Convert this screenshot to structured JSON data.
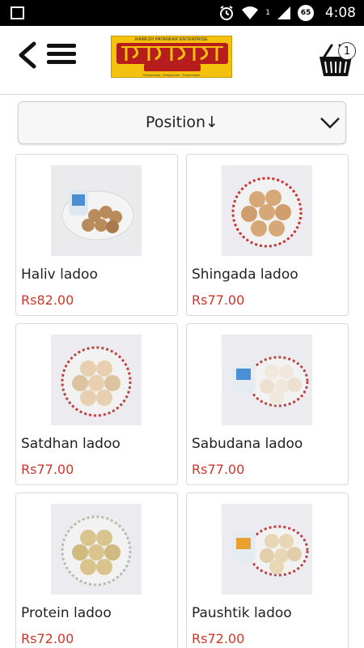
{
  "status_bar": {
    "time": "4:08",
    "battery_level": "65",
    "signal_label": "1",
    "icons": [
      "square-notification-icon",
      "alarm-icon",
      "wifi-icon",
      "signal-icon",
      "battery-icon"
    ]
  },
  "header": {
    "back_icon": "chevron-left-icon",
    "menu_icon": "hamburger-menu-icon",
    "logo": {
      "top_line": "RAMESH PATANKAR ENTERPRISE",
      "tagline": "Paramanam...Paripurnam...Paramanam"
    },
    "cart": {
      "icon": "shopping-basket-icon",
      "count": "1"
    }
  },
  "sort": {
    "label": "Position↓",
    "icon": "chevron-down-icon"
  },
  "products": [
    {
      "name": "Haliv ladoo",
      "price": "Rs82.00"
    },
    {
      "name": "Shingada ladoo",
      "price": "Rs77.00"
    },
    {
      "name": "Satdhan ladoo",
      "price": "Rs77.00"
    },
    {
      "name": "Sabudana ladoo",
      "price": "Rs77.00"
    },
    {
      "name": "Protein ladoo",
      "price": "Rs72.00"
    },
    {
      "name": "Paushtik ladoo",
      "price": "Rs72.00"
    }
  ],
  "colors": {
    "price": "#d0352b",
    "logo_yellow": "#f4c20d",
    "logo_red": "#b81d1d"
  }
}
